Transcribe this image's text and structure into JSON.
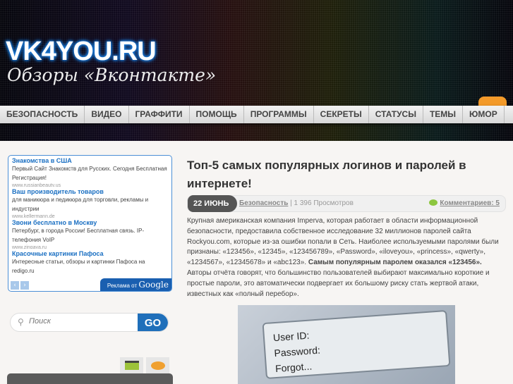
{
  "header": {
    "logo": "VK4YOU.RU",
    "tagline": "Обзоры «Вконтакте»"
  },
  "nav": [
    "БЕЗОПАСНОСТЬ",
    "ВИДЕО",
    "ГРАФФИТИ",
    "ПОМОЩЬ",
    "ПРОГРАММЫ",
    "СЕКРЕТЫ",
    "СТАТУСЫ",
    "ТЕМЫ",
    "ЮМОР"
  ],
  "ads": {
    "items": [
      {
        "title": "Знакомства в США",
        "desc": "Первый Сайт Знакомств для Русских. Сегодня Бесплатная Регистрация!",
        "url": "www.russianbeauty.us"
      },
      {
        "title": "Ваш производитель товаров",
        "desc": "для маникюра и педикюра для торговли, рекламы и индустрии",
        "url": "www.kellermann.de"
      },
      {
        "title": "Звони бесплатно в Москву",
        "desc": "Петербург, в города России! Бесплатная связь. IP-телефония VoIP",
        "url": "www.zingaya.ru"
      },
      {
        "title": "Красочные картинки Пафоса",
        "desc": "Интересные статьи, обзоры и картинки Пафоса на redigo.ru",
        "url": ""
      }
    ],
    "label": "Реклама от",
    "brand": "Google"
  },
  "search": {
    "placeholder": "Поиск",
    "button": "GO"
  },
  "article": {
    "title": "Топ-5 самых популярных логинов и паролей в интернете!",
    "date": "22 ИЮНЬ",
    "category": "Безопасность",
    "views": "| 1 396 Просмотров",
    "comments": "Комментариев: 5",
    "body_1": "Крупная американская компания Imperva, которая работает в области информационной безопасности, предоставила собственное исследование 32 миллионов паролей сайта Rockyou.com, которые из-за ошибки попали в Сеть. Наиболее используемыми паролями были признаны: «123456», «12345», «123456789», «Password», «iloveyou», «princess», «qwerty», «1234567», «12345678» и «abc123».",
    "body_bold": "Самым популярным паролем оказался «123456».",
    "body_2": "Авторы отчёта говорят, что большинство пользователей выбирают максимально короткие и простые пароли, это автоматически подвергает их большому риску стать жертвой атаки, известных как «полный перебор».",
    "image": {
      "user_id": "User ID:",
      "password": "Password:",
      "forgot": "Forgot..."
    }
  }
}
